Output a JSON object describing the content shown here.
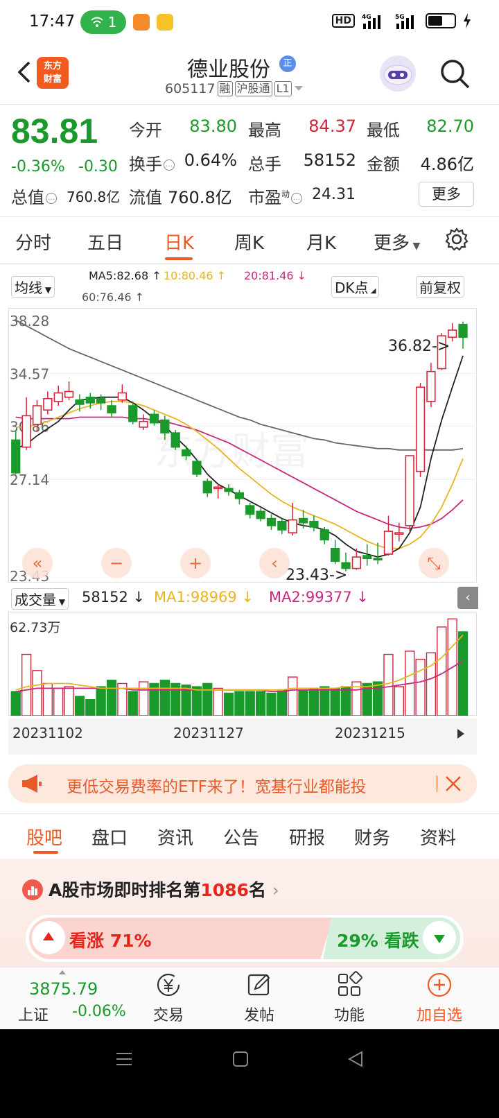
{
  "status_bar": {
    "time": "17:47",
    "wifi_count": "1",
    "network_labels": [
      "HD",
      "4G",
      "5G"
    ]
  },
  "header": {
    "logo_text_line1": "东方",
    "logo_text_line2": "财富",
    "stock_name": "德业股份",
    "name_badge": "正",
    "stock_code": "605117",
    "tag_margin": "融",
    "tag_market": "沪股通",
    "tag_level": "L1"
  },
  "quote": {
    "price": "83.81",
    "change_pct": "-0.36%",
    "change_abs": "-0.30",
    "open_label": "今开",
    "open_value": "83.80",
    "high_label": "最高",
    "high_value": "84.37",
    "low_label": "最低",
    "low_value": "82.70",
    "turnover_label": "换手",
    "turnover_value": "0.64%",
    "volume_label": "总手",
    "volume_value": "58152",
    "amount_label": "金额",
    "amount_value": "4.86亿",
    "total_cap_label": "总值",
    "total_cap_value": "760.8亿",
    "float_cap_label": "流值",
    "float_cap_value": "760.8亿",
    "pe_label": "市盈",
    "pe_sup": "动",
    "pe_value": "24.31",
    "more_button": "更多"
  },
  "period_tabs": [
    "分时",
    "五日",
    "日K",
    "周K",
    "月K",
    "更多"
  ],
  "active_period": 2,
  "ma_legend": {
    "selector": "均线",
    "ma5": "MA5:82.68",
    "ma10": "10:80.46",
    "ma20": "20:81.46",
    "ma60": "60:76.46",
    "dk_button": "DK点",
    "adjust_button": "前复权"
  },
  "colors": {
    "up": "#d0263a",
    "down": "#1a9a2a",
    "accent": "#f15a22",
    "ma5": "#222222",
    "ma10": "#e8b520",
    "ma20": "#c8287e",
    "ma60": "#666666"
  },
  "kline_axis": {
    "y_ticks": [
      "38.28",
      "34.57",
      "30.86",
      "27.14",
      "23.43"
    ],
    "high_marker": "36.82->",
    "low_marker": "23.43->"
  },
  "volume_legend": {
    "selector": "成交量",
    "value": "58152",
    "ma1": "MA1:98969",
    "ma2": "MA2:99377",
    "max_label": "62.73万"
  },
  "x_dates": [
    "20231102",
    "20231127",
    "20231215"
  ],
  "chart_data": {
    "type": "candlestick",
    "ylim": [
      23.43,
      38.28
    ],
    "candles": [
      {
        "o": 29.9,
        "c": 27.6,
        "h": 30.6,
        "l": 27.5
      },
      {
        "o": 29.4,
        "c": 31.6,
        "h": 32.9,
        "l": 29.2
      },
      {
        "o": 31.0,
        "c": 32.3,
        "h": 32.7,
        "l": 30.5
      },
      {
        "o": 32.0,
        "c": 32.8,
        "h": 33.3,
        "l": 31.7
      },
      {
        "o": 32.6,
        "c": 33.2,
        "h": 33.7,
        "l": 32.3
      },
      {
        "o": 32.9,
        "c": 33.3,
        "h": 34.0,
        "l": 32.7
      },
      {
        "o": 32.7,
        "c": 32.4,
        "h": 33.1,
        "l": 31.9
      },
      {
        "o": 32.9,
        "c": 32.5,
        "h": 33.2,
        "l": 32.1
      },
      {
        "o": 32.8,
        "c": 32.5,
        "h": 33.1,
        "l": 32.0
      },
      {
        "o": 32.3,
        "c": 31.8,
        "h": 32.7,
        "l": 31.5
      },
      {
        "o": 32.7,
        "c": 33.2,
        "h": 33.8,
        "l": 32.5
      },
      {
        "o": 32.3,
        "c": 31.2,
        "h": 32.6,
        "l": 31.0
      },
      {
        "o": 30.8,
        "c": 31.2,
        "h": 31.7,
        "l": 30.6
      },
      {
        "o": 31.7,
        "c": 31.1,
        "h": 32.0,
        "l": 30.9
      },
      {
        "o": 31.3,
        "c": 30.4,
        "h": 31.6,
        "l": 29.9
      },
      {
        "o": 30.4,
        "c": 29.4,
        "h": 30.6,
        "l": 29.2
      },
      {
        "o": 29.2,
        "c": 28.8,
        "h": 29.5,
        "l": 28.5
      },
      {
        "o": 28.4,
        "c": 27.5,
        "h": 28.6,
        "l": 27.3
      },
      {
        "o": 27.0,
        "c": 26.2,
        "h": 27.2,
        "l": 25.9
      },
      {
        "o": 26.5,
        "c": 26.6,
        "h": 26.8,
        "l": 25.8
      },
      {
        "o": 26.5,
        "c": 26.3,
        "h": 26.8,
        "l": 26.0
      },
      {
        "o": 26.2,
        "c": 25.8,
        "h": 26.4,
        "l": 25.4
      },
      {
        "o": 25.3,
        "c": 24.7,
        "h": 25.5,
        "l": 24.4
      },
      {
        "o": 24.9,
        "c": 24.4,
        "h": 25.1,
        "l": 24.2
      },
      {
        "o": 24.4,
        "c": 23.9,
        "h": 24.7,
        "l": 23.6
      },
      {
        "o": 24.2,
        "c": 23.6,
        "h": 24.4,
        "l": 23.3
      },
      {
        "o": 23.4,
        "c": 24.3,
        "h": 25.5,
        "l": 23.2
      },
      {
        "o": 24.4,
        "c": 24.1,
        "h": 25.0,
        "l": 23.7
      },
      {
        "o": 24.2,
        "c": 23.8,
        "h": 24.6,
        "l": 23.5
      },
      {
        "o": 23.6,
        "c": 22.9,
        "h": 23.8,
        "l": 22.6
      },
      {
        "o": 22.3,
        "c": 21.4,
        "h": 22.9,
        "l": 21.2
      },
      {
        "o": 21.3,
        "c": 20.9,
        "h": 22.0,
        "l": 20.7
      },
      {
        "o": 20.9,
        "c": 21.7,
        "h": 22.3,
        "l": 20.8
      },
      {
        "o": 21.8,
        "c": 21.6,
        "h": 22.6,
        "l": 21.1
      },
      {
        "o": 21.6,
        "c": 21.5,
        "h": 22.7,
        "l": 21.2
      },
      {
        "o": 21.9,
        "c": 23.5,
        "h": 24.6,
        "l": 21.8
      },
      {
        "o": 23.3,
        "c": 23.4,
        "h": 24.1,
        "l": 22.8
      },
      {
        "o": 23.9,
        "c": 28.8,
        "h": 28.8,
        "l": 23.5
      },
      {
        "o": 27.7,
        "c": 33.6,
        "h": 33.9,
        "l": 27.3
      },
      {
        "o": 32.6,
        "c": 34.7,
        "h": 35.3,
        "l": 32.2
      },
      {
        "o": 34.9,
        "c": 37.2,
        "h": 37.4,
        "l": 34.8
      },
      {
        "o": 37.1,
        "c": 37.6,
        "h": 38.1,
        "l": 36.8
      },
      {
        "o": 38.0,
        "c": 37.1,
        "h": 38.2,
        "l": 36.3
      }
    ],
    "ma5": [
      29.3,
      29.6,
      30.2,
      30.7,
      31.2,
      32.0,
      32.7,
      32.8,
      32.9,
      32.9,
      32.9,
      32.5,
      32.0,
      31.4,
      30.9,
      30.1,
      29.4,
      28.5,
      27.5,
      26.8,
      26.4,
      26.0,
      25.6,
      25.2,
      24.8,
      24.4,
      24.1,
      23.9,
      23.8,
      23.6,
      23.2,
      22.6,
      22.1,
      21.9,
      21.7,
      21.9,
      22.3,
      23.4,
      25.2,
      28.6,
      31.3,
      33.6,
      35.8
    ],
    "ma10": [
      30.8,
      30.8,
      31.0,
      31.2,
      31.5,
      31.8,
      32.1,
      32.3,
      32.5,
      32.6,
      32.6,
      32.5,
      32.3,
      32.0,
      31.7,
      31.4,
      31.0,
      30.5,
      29.9,
      29.3,
      28.6,
      27.9,
      27.3,
      26.7,
      26.1,
      25.6,
      25.2,
      24.9,
      24.6,
      24.3,
      24.0,
      23.6,
      23.2,
      22.8,
      22.5,
      22.3,
      22.3,
      22.6,
      23.1,
      24.0,
      25.2,
      26.8,
      28.6
    ],
    "ma20": [
      31.5,
      31.4,
      31.4,
      31.4,
      31.4,
      31.4,
      31.5,
      31.5,
      31.5,
      31.5,
      31.5,
      31.4,
      31.4,
      31.3,
      31.2,
      31.0,
      30.8,
      30.6,
      30.3,
      30.0,
      29.7,
      29.3,
      28.9,
      28.5,
      28.1,
      27.7,
      27.3,
      26.9,
      26.5,
      26.1,
      25.7,
      25.3,
      24.9,
      24.6,
      24.3,
      24.0,
      23.8,
      23.7,
      23.8,
      24.0,
      24.4,
      25.0,
      25.7
    ],
    "ma60": [
      38.3,
      37.9,
      37.5,
      37.1,
      36.7,
      36.3,
      36.0,
      35.7,
      35.4,
      35.1,
      34.8,
      34.5,
      34.2,
      33.9,
      33.6,
      33.3,
      33.0,
      32.7,
      32.4,
      32.1,
      31.8,
      31.5,
      31.3,
      31.0,
      30.8,
      30.6,
      30.4,
      30.2,
      30.0,
      29.9,
      29.7,
      29.6,
      29.5,
      29.4,
      29.3,
      29.3,
      29.2,
      29.2,
      29.2,
      29.2,
      29.2,
      29.2,
      29.3
    ],
    "volume": [
      15,
      38,
      28,
      20,
      17,
      18,
      12,
      10,
      18,
      22,
      20,
      15,
      21,
      20,
      22,
      20,
      19,
      18,
      20,
      17,
      14,
      15,
      15,
      15,
      14,
      16,
      24,
      16,
      17,
      18,
      17,
      18,
      21,
      20,
      21,
      38,
      18,
      40,
      35,
      39,
      55,
      60,
      52
    ],
    "vol_ma1": [
      16,
      18,
      19,
      20,
      20,
      20,
      19,
      18,
      17,
      17,
      17,
      17,
      17,
      17,
      17,
      17,
      17,
      16,
      16,
      16,
      16,
      16,
      16,
      16,
      16,
      16,
      17,
      17,
      17,
      17,
      17,
      18,
      18,
      18,
      19,
      20,
      22,
      25,
      28,
      31,
      36,
      43,
      50
    ],
    "vol_ma2": [
      15,
      16,
      17,
      17,
      17,
      17,
      17,
      17,
      17,
      17,
      17,
      16,
      16,
      16,
      16,
      16,
      16,
      16,
      16,
      16,
      16,
      16,
      16,
      16,
      15,
      15,
      16,
      16,
      16,
      16,
      16,
      16,
      16,
      17,
      17,
      18,
      19,
      20,
      21,
      23,
      26,
      30,
      34
    ]
  },
  "nav_controls": [
    "«",
    "−",
    "+",
    "‹",
    "⤡"
  ],
  "banner": {
    "text": "更低交易费率的ETF来了！宽基行业都能投"
  },
  "bottom_tabs": [
    "股吧",
    "盘口",
    "资讯",
    "公告",
    "研报",
    "财务",
    "资料"
  ],
  "active_bottom_tab": 0,
  "ranking": {
    "prefix": "A股市场即时排名第",
    "number": "1086",
    "suffix": "名",
    "arrow": "›"
  },
  "vote": {
    "up_text": "看涨 71%",
    "down_text": "29% 看跌"
  },
  "bottom_nav": {
    "index_value": "3875.79",
    "index_name": "上证",
    "index_change": "-0.06%",
    "trade": "交易",
    "post": "发帖",
    "functions": "功能",
    "add_watch": "加自选"
  }
}
